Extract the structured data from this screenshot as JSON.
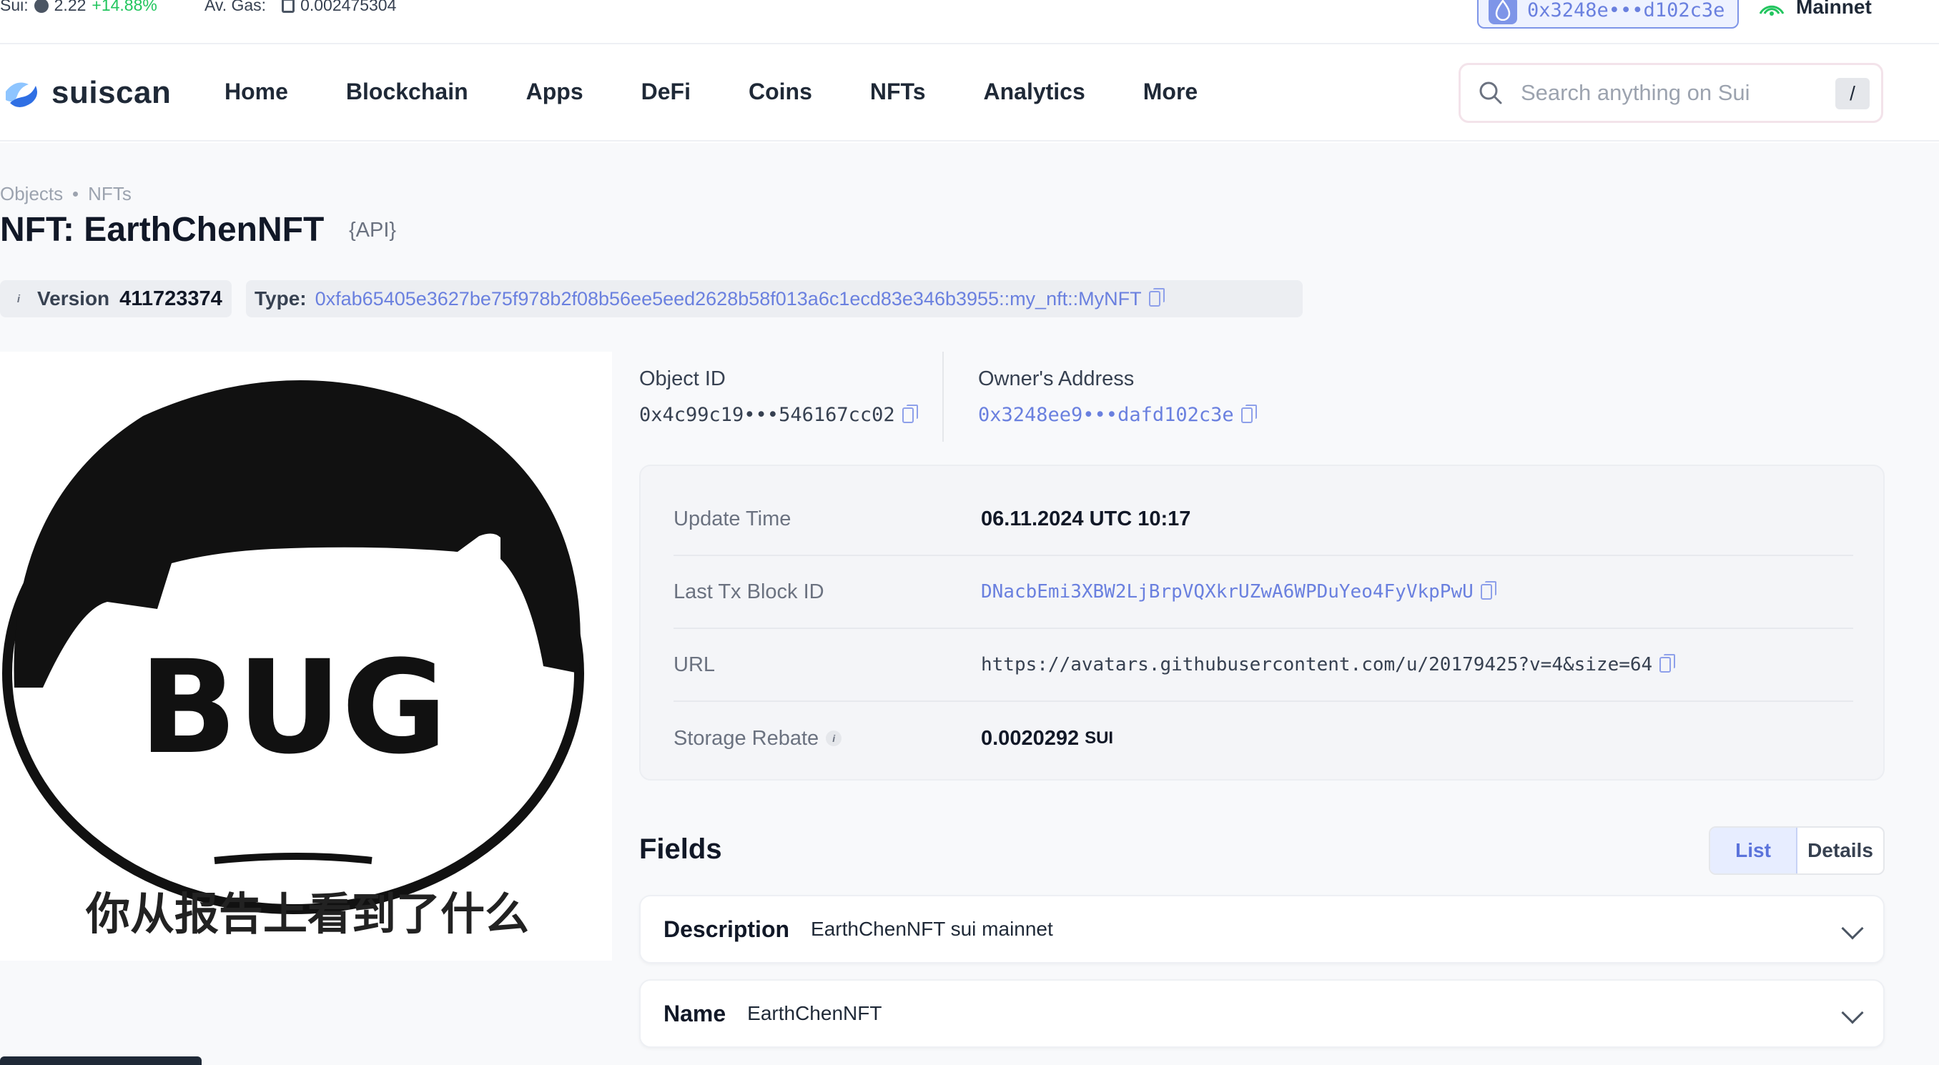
{
  "stats": {
    "sui_label": "Sui:",
    "sui_price": "2.22",
    "sui_change": "+14.88%",
    "gas_label": "Av. Gas:",
    "gas_value": "0.002475304"
  },
  "wallet": {
    "address": "0x3248e•••d102c3e"
  },
  "network": {
    "label": "Mainnet"
  },
  "logo": {
    "text": "suiscan"
  },
  "nav": {
    "items": [
      {
        "label": "Home"
      },
      {
        "label": "Blockchain"
      },
      {
        "label": "Apps"
      },
      {
        "label": "DeFi"
      },
      {
        "label": "Coins"
      },
      {
        "label": "NFTs"
      },
      {
        "label": "Analytics"
      },
      {
        "label": "More"
      }
    ]
  },
  "search": {
    "placeholder": "Search anything on Sui",
    "shortcut": "/"
  },
  "breadcrumb": {
    "items": [
      "Objects",
      "NFTs"
    ]
  },
  "page": {
    "title": "NFT: EarthChenNFT",
    "api_tag": "{API}"
  },
  "version": {
    "label": "Version",
    "value": "411723374"
  },
  "type": {
    "label": "Type:",
    "value": "0xfab65405e3627be75f978b2f08b56ee5eed2628b58f013a6c1ecd83e346b3955::my_nft::MyNFT"
  },
  "nft_image": {
    "caption": "你从报告上看到了什么",
    "badge_text": "BUG"
  },
  "object": {
    "id_label": "Object ID",
    "id_value": "0x4c99c19•••546167cc02",
    "owner_label": "Owner's Address",
    "owner_value": "0x3248ee9•••dafd102c3e"
  },
  "details": {
    "rows": [
      {
        "key": "Update Time",
        "value": "06.11.2024 UTC 10:17"
      },
      {
        "key": "Last Tx Block ID",
        "value": "DNacbEmi3XBW2LjBrpVQXkrUZwA6WPDuYeo4FyVkpPwU"
      },
      {
        "key": "URL",
        "value": "https://avatars.githubusercontent.com/u/20179425?v=4&size=64"
      },
      {
        "key": "Storage Rebate",
        "value": "0.0020292",
        "unit": "SUI"
      }
    ]
  },
  "fields": {
    "title": "Fields",
    "view_list": "List",
    "view_details": "Details",
    "items": [
      {
        "key": "Description",
        "value": "EarthChenNFT sui mainnet"
      },
      {
        "key": "Name",
        "value": "EarthChenNFT"
      }
    ]
  },
  "colors": {
    "accent": "#6a80df",
    "positive": "#22c55e",
    "background": "#f8f9fb"
  }
}
